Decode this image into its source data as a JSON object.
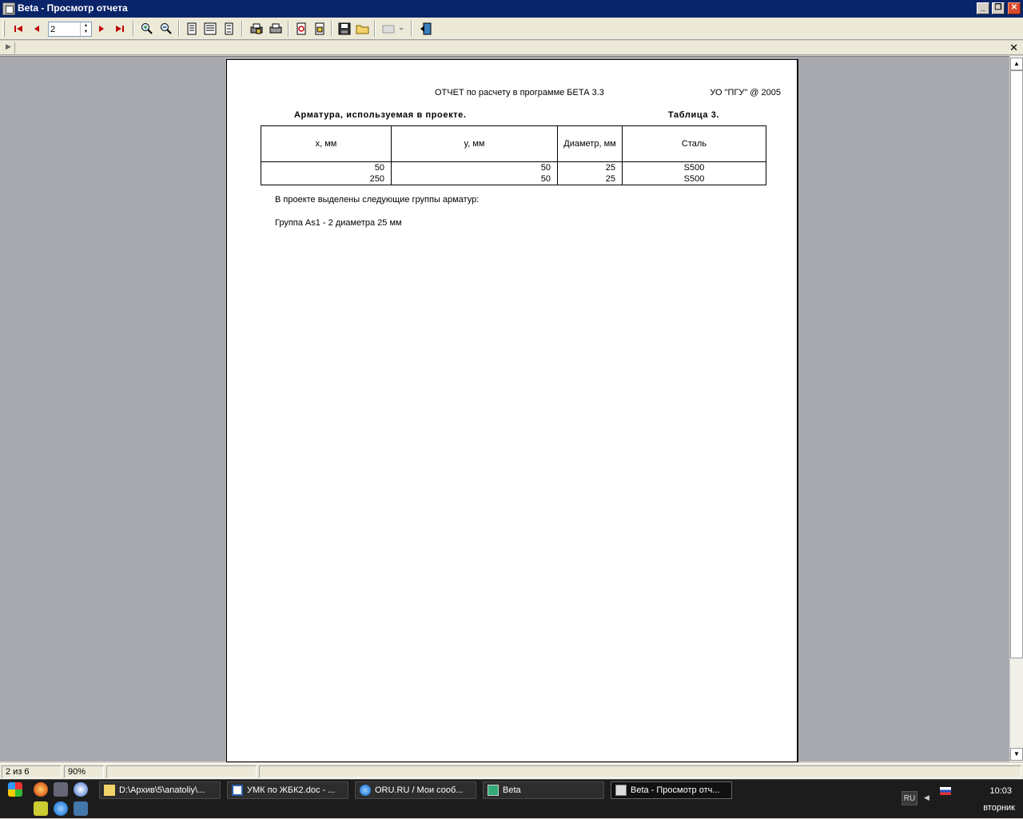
{
  "window": {
    "title": "Beta - Просмотр отчета"
  },
  "toolbar": {
    "page_value": "2"
  },
  "report": {
    "header_left": "ОТЧЕТ по расчету в программе БЕТА 3.3",
    "header_right": "УО \"ПГУ\" @ 2005",
    "title": "Арматура, используемая в проекте.",
    "table_number": "Таблица 3.",
    "columns": [
      "x, мм",
      "y, мм",
      "Диаметр, мм",
      "Сталь"
    ],
    "rows": [
      [
        "50",
        "50",
        "25",
        "S500"
      ],
      [
        "250",
        "50",
        "25",
        "S500"
      ]
    ],
    "text1": "В проекте выделены следующие группы арматур:",
    "text2": "Группа As1 - 2 диаметра 25 мм"
  },
  "status": {
    "page_info": "2 из 6",
    "zoom": "90%"
  },
  "taskbar": {
    "items": [
      "D:\\Архив\\5\\anatoliy\\...",
      "УМК по ЖБК2.doc - ...",
      "ORU.RU / Мои сооб...",
      "Beta",
      "Beta - Просмотр отч..."
    ],
    "lang": "RU",
    "time": "10:03",
    "day": "вторник"
  }
}
